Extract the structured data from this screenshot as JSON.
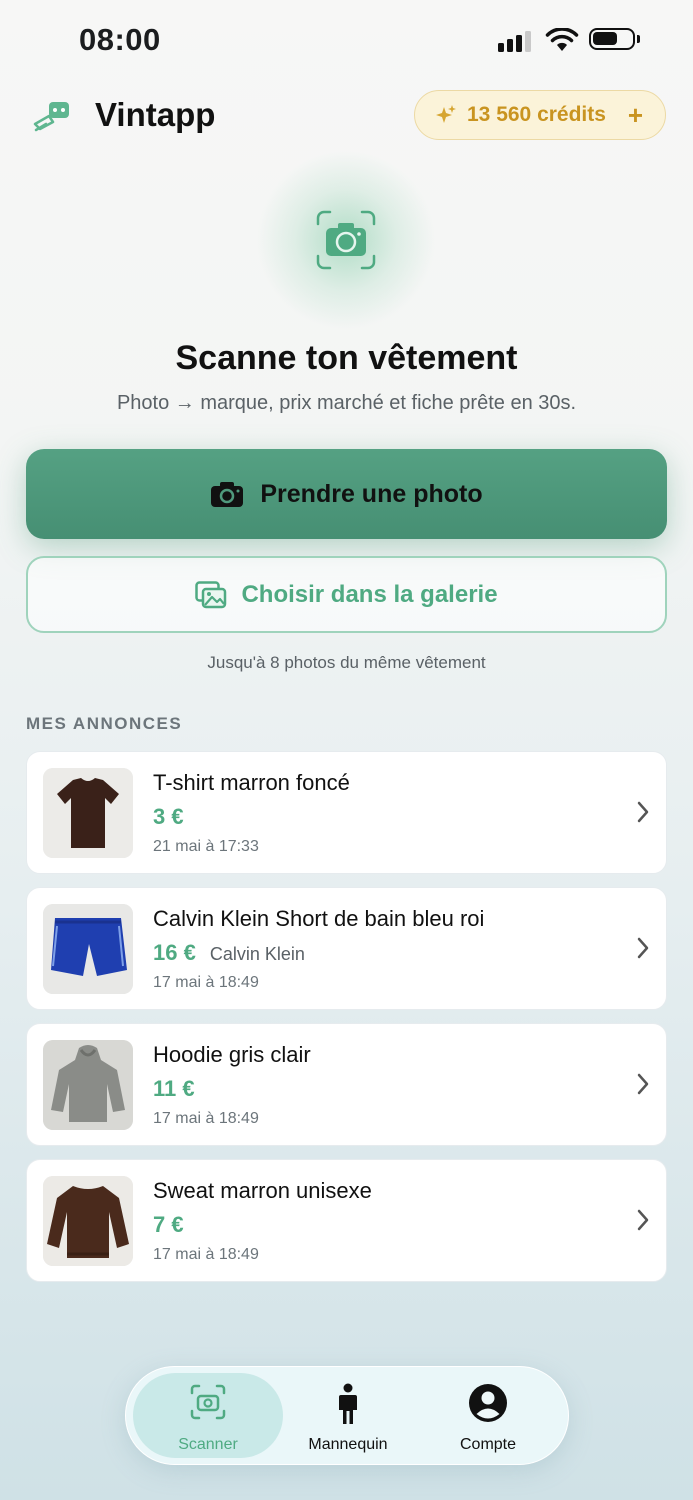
{
  "status_bar": {
    "time": "08:00"
  },
  "header": {
    "app_name": "Vintapp",
    "credits_label": "13 560 crédits",
    "credits_add": "+"
  },
  "hero": {
    "title": "Scanne ton vêtement",
    "subtitle": "Photo → marque, prix marché et fiche prête en 30s."
  },
  "actions": {
    "take_photo": "Prendre une photo",
    "choose_gallery": "Choisir dans la galerie",
    "hint": "Jusqu'à 8 photos du même vêtement"
  },
  "listings_section": {
    "label": "MES ANNONCES",
    "items": [
      {
        "title": "T-shirt marron foncé",
        "price": "3 €",
        "brand": "",
        "date": "21 mai à 17:33",
        "thumb_color": "#3a2119"
      },
      {
        "title": "Calvin Klein Short de bain bleu roi",
        "price": "16 €",
        "brand": "Calvin Klein",
        "date": "17 mai à 18:49",
        "thumb_color": "#1f3fb0"
      },
      {
        "title": "Hoodie gris clair",
        "price": "11 €",
        "brand": "",
        "date": "17 mai à 18:49",
        "thumb_color": "#8a8c88"
      },
      {
        "title": "Sweat marron unisexe",
        "price": "7 €",
        "brand": "",
        "date": "17 mai à 18:49",
        "thumb_color": "#4a2a1c"
      }
    ]
  },
  "tabbar": {
    "tabs": [
      {
        "label": "Scanner",
        "icon": "camera-scan-icon",
        "active": true
      },
      {
        "label": "Mannequin",
        "icon": "person-icon",
        "active": false
      },
      {
        "label": "Compte",
        "icon": "account-icon",
        "active": false
      }
    ]
  },
  "colors": {
    "accent": "#4faa82",
    "primary_button": "#4f9a7d",
    "credits_text": "#c99420"
  }
}
